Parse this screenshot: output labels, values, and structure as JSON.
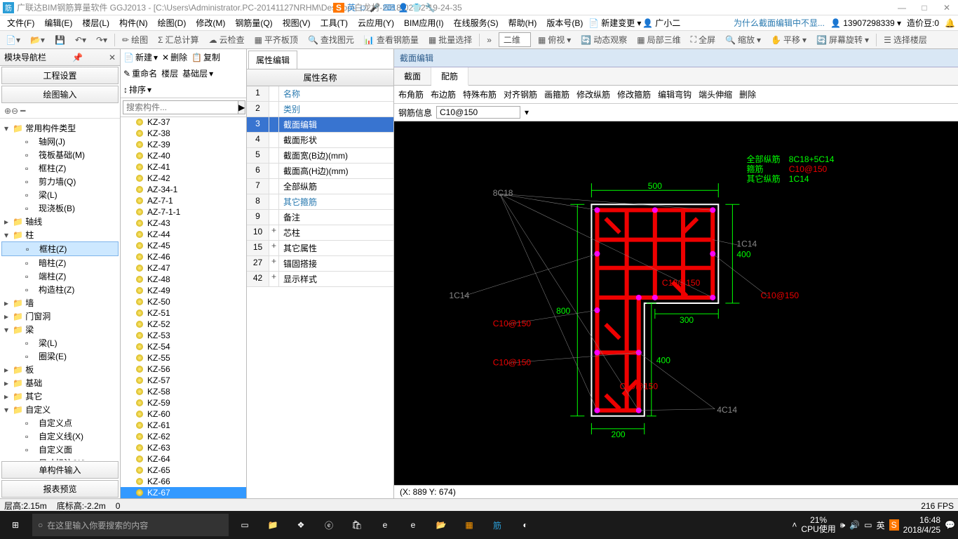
{
  "title": {
    "app": "广联达BIM钢筋算量软件 GGJ2013 - [C:\\Users\\Administrator.PC-20141127NRHM\\Desktop\\白龙村-2018-02-02-19-24-35",
    "ime_label": "英"
  },
  "menu": {
    "items": [
      "文件(F)",
      "编辑(E)",
      "楼层(L)",
      "构件(N)",
      "绘图(D)",
      "修改(M)",
      "钢筋量(Q)",
      "视图(V)",
      "工具(T)",
      "云应用(Y)",
      "BIM应用(I)",
      "在线服务(S)",
      "帮助(H)",
      "版本号(B)"
    ],
    "new_change": "新建变更",
    "user": "广小二",
    "tip": "为什么截面编辑中不显...",
    "phone": "13907298339",
    "coin": "造价豆:0"
  },
  "toolbar": {
    "items": [
      "绘图",
      "汇总计算",
      "云检查",
      "平齐板顶",
      "查找图元",
      "查看钢筋量",
      "批量选择"
    ],
    "view_combo": "二维",
    "right": [
      "俯视",
      "动态观察",
      "局部三维",
      "全屏",
      "缩放",
      "平移",
      "屏幕旋转",
      "选择楼层"
    ]
  },
  "left": {
    "panel_title": "模块导航栏",
    "acc1": "工程设置",
    "acc2": "绘图输入",
    "acc3": "单构件输入",
    "acc4": "报表预览",
    "tree": {
      "groups": [
        {
          "label": "常用构件类型",
          "open": true,
          "children": [
            {
              "label": "轴网(J)"
            },
            {
              "label": "筏板基础(M)"
            },
            {
              "label": "框柱(Z)"
            },
            {
              "label": "剪力墙(Q)"
            },
            {
              "label": "梁(L)"
            },
            {
              "label": "现浇板(B)"
            }
          ]
        },
        {
          "label": "轴线",
          "open": false
        },
        {
          "label": "柱",
          "open": true,
          "children": [
            {
              "label": "框柱(Z)",
              "selected": true
            },
            {
              "label": "暗柱(Z)"
            },
            {
              "label": "端柱(Z)"
            },
            {
              "label": "构造柱(Z)"
            }
          ]
        },
        {
          "label": "墙",
          "open": false
        },
        {
          "label": "门窗洞",
          "open": false
        },
        {
          "label": "梁",
          "open": true,
          "children": [
            {
              "label": "梁(L)"
            },
            {
              "label": "圈梁(E)"
            }
          ]
        },
        {
          "label": "板",
          "open": false
        },
        {
          "label": "基础",
          "open": false
        },
        {
          "label": "其它",
          "open": false
        },
        {
          "label": "自定义",
          "open": true,
          "children": [
            {
              "label": "自定义点"
            },
            {
              "label": "自定义线(X)"
            },
            {
              "label": "自定义面"
            },
            {
              "label": "尺寸标注(W)"
            }
          ]
        }
      ]
    }
  },
  "components": {
    "toolbar": {
      "new": "新建",
      "del": "删除",
      "copy": "复制",
      "rename": "重命名",
      "floor": "楼层",
      "base": "基础层",
      "sort": "排序"
    },
    "search_placeholder": "搜索构件...",
    "items": [
      "KZ-37",
      "KZ-38",
      "KZ-39",
      "KZ-40",
      "KZ-41",
      "KZ-42",
      "AZ-34-1",
      "AZ-7-1",
      "AZ-7-1-1",
      "KZ-43",
      "KZ-44",
      "KZ-45",
      "KZ-46",
      "KZ-47",
      "KZ-48",
      "KZ-49",
      "KZ-50",
      "KZ-51",
      "KZ-52",
      "KZ-53",
      "KZ-54",
      "KZ-55",
      "KZ-56",
      "KZ-57",
      "KZ-58",
      "KZ-59",
      "KZ-60",
      "KZ-61",
      "KZ-62",
      "KZ-63",
      "KZ-64",
      "KZ-65",
      "KZ-66",
      "KZ-67"
    ],
    "selected": "KZ-67"
  },
  "properties": {
    "tab": "属性编辑",
    "header": "属性名称",
    "rows": [
      {
        "n": "1",
        "name": "名称",
        "blue": true
      },
      {
        "n": "2",
        "name": "类别",
        "blue": true
      },
      {
        "n": "3",
        "name": "截面编辑",
        "blue": true,
        "selected": true
      },
      {
        "n": "4",
        "name": "截面形状"
      },
      {
        "n": "5",
        "name": "截面宽(B边)(mm)"
      },
      {
        "n": "6",
        "name": "截面高(H边)(mm)"
      },
      {
        "n": "7",
        "name": "全部纵筋"
      },
      {
        "n": "8",
        "name": "其它箍筋",
        "blue": true
      },
      {
        "n": "9",
        "name": "备注"
      },
      {
        "n": "10",
        "name": "芯柱",
        "exp": "+"
      },
      {
        "n": "15",
        "name": "其它属性",
        "exp": "+"
      },
      {
        "n": "27",
        "name": "锚固搭接",
        "exp": "+"
      },
      {
        "n": "42",
        "name": "显示样式",
        "exp": "+"
      }
    ]
  },
  "section": {
    "title": "截面编辑",
    "tabs": [
      "截面",
      "配筋"
    ],
    "active_tab": "配筋",
    "rebar_toolbar": [
      "布角筋",
      "布边筋",
      "特殊布筋",
      "对齐钢筋",
      "画箍筋",
      "修改纵筋",
      "修改箍筋",
      "编辑弯钩",
      "端头伸缩",
      "删除"
    ],
    "rebar_label": "钢筋信息",
    "rebar_value": "C10@150",
    "legend": {
      "all": {
        "label": "全部纵筋",
        "val": "8C18+5C14"
      },
      "stirrup": {
        "label": "箍筋",
        "val": "C10@150"
      },
      "other": {
        "label": "其它纵筋",
        "val": "1C14"
      }
    },
    "dims": {
      "w1": "500",
      "w2": "200",
      "w3": "300",
      "h1": "800",
      "h2": "400",
      "h3": "400"
    },
    "annot": [
      "8C18",
      "1C14",
      "1C14",
      "4C14",
      "C10@150",
      "C10@150",
      "C10@150",
      "C10@150",
      "C10@150"
    ],
    "coord": "(X: 889 Y: 674)",
    "fps": "216 FPS"
  },
  "status": {
    "floor_h": "层高:2.15m",
    "base_h": "底标高:-2.2m",
    "zero": "0"
  },
  "taskbar": {
    "search": "在这里输入你要搜索的内容",
    "cpu": "21%",
    "cpu_label": "CPU使用",
    "time": "16:48",
    "date": "2018/4/25",
    "ime": "英"
  }
}
